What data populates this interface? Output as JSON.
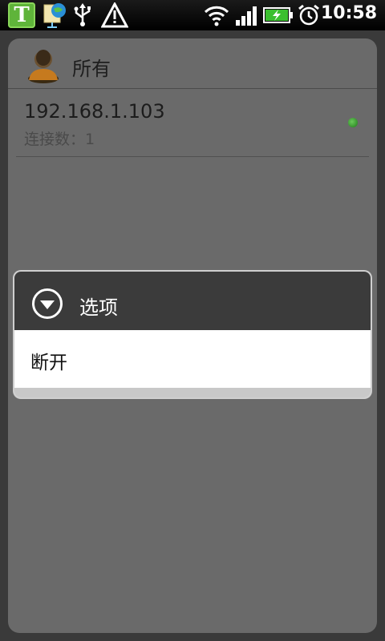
{
  "status_bar": {
    "time": "10:58",
    "app_icon_letter": "T",
    "icons": [
      "app-t-icon",
      "network-globe-icon",
      "usb-icon",
      "warning-icon",
      "wifi-icon",
      "signal-icon",
      "battery-charging-icon",
      "alarm-clock-icon"
    ]
  },
  "header": {
    "title": "所有",
    "icon": "user-avatar-icon"
  },
  "connections": [
    {
      "ip": "192.168.1.103",
      "count_label": "连接数：1",
      "status": "online"
    }
  ],
  "dialog": {
    "title": "选项",
    "icon": "dropdown-circle-icon",
    "items": [
      {
        "label": "断开"
      }
    ]
  },
  "colors": {
    "status_online": "#3fa83a",
    "dialog_title_bg": "#3b3b3b",
    "card_bg": "#6a6a6a"
  }
}
